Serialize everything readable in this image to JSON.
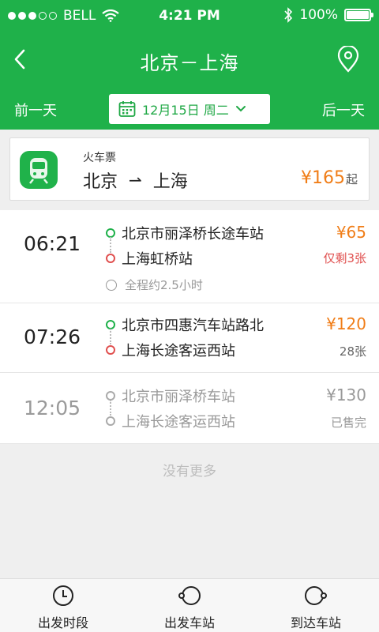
{
  "status_bar": {
    "carrier": "BELL",
    "time": "4:21 PM",
    "battery": "100%"
  },
  "nav": {
    "title": "北京－上海",
    "back_icon": "chevron-left-icon",
    "location_icon": "location-pin-icon"
  },
  "date_bar": {
    "prev": "前一天",
    "date": "12月15日 周二",
    "next": "后一天"
  },
  "train_card": {
    "label": "火车票",
    "from": "北京",
    "arrow": "⇀",
    "to": "上海",
    "price": "¥165",
    "price_suffix": "起"
  },
  "routes": [
    {
      "time": "06:21",
      "from": "北京市丽泽桥长途车站",
      "to": "上海虹桥站",
      "price": "¥65",
      "remain": "仅剩3张",
      "duration": "全程约2.5小时"
    },
    {
      "time": "07:26",
      "from": "北京市四惠汽车站路北",
      "to": "上海长途客运西站",
      "price": "¥120",
      "remain": "28张"
    },
    {
      "time": "12:05",
      "from": "北京市丽泽桥车站",
      "to": "上海长途客运西站",
      "price": "¥130",
      "remain": "已售完"
    }
  ],
  "footer_note": "没有更多",
  "tabs": [
    {
      "label": "出发时段",
      "icon": "clock-icon"
    },
    {
      "label": "出发车站",
      "icon": "departure-station-icon"
    },
    {
      "label": "到达车站",
      "icon": "arrival-station-icon"
    }
  ],
  "colors": {
    "brand": "#1fb14a",
    "price": "#f07d17",
    "warn": "#e0504f"
  }
}
